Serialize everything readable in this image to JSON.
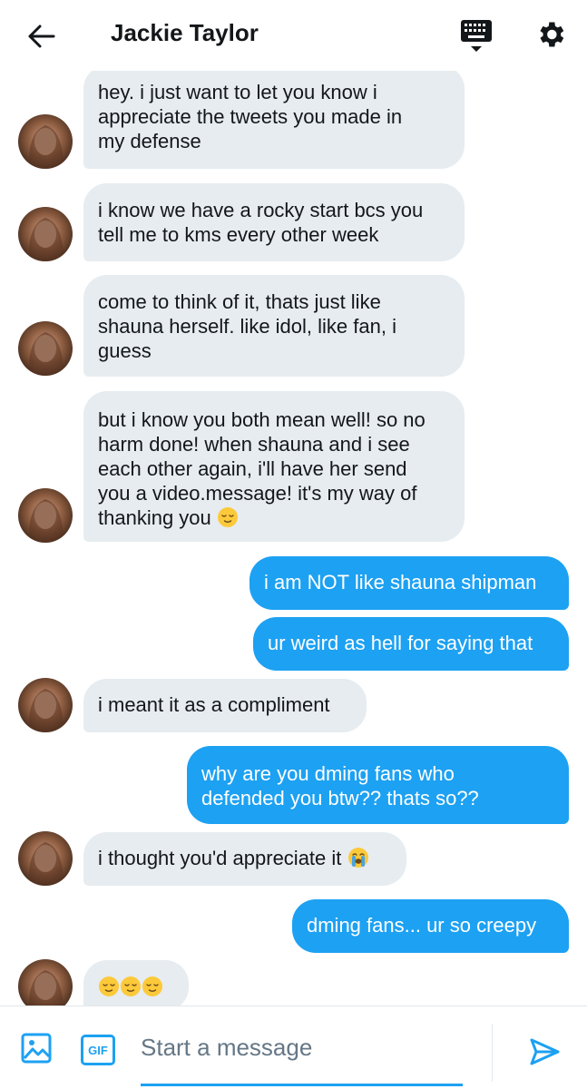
{
  "header": {
    "title": "Jackie Taylor",
    "back_icon": "arrow-left-icon",
    "keyboard_icon": "keyboard-icon",
    "settings_icon": "gear-icon"
  },
  "messages": [
    {
      "from": "them",
      "lines": [
        "hey. i just want to let you know i",
        "appreciate the tweets you made in",
        "my defense"
      ]
    },
    {
      "from": "them",
      "lines": [
        "i know we have a rocky start bcs you",
        "tell me to kms every other week"
      ]
    },
    {
      "from": "them",
      "lines": [
        "come to think of it, thats just like",
        "shauna herself. like idol, like fan, i",
        "guess"
      ]
    },
    {
      "from": "them",
      "lines": [
        "but i know you both mean well! so no",
        "harm done! when shauna and i see",
        "each other again, i'll have her send",
        "you a video.message! it's my way of",
        "thanking you"
      ],
      "emoji": "relieved-face"
    },
    {
      "from": "me",
      "lines": [
        "i am NOT like shauna shipman"
      ]
    },
    {
      "from": "me",
      "lines": [
        "ur weird as hell for saying that"
      ]
    },
    {
      "from": "them",
      "lines": [
        "i meant it as a compliment"
      ]
    },
    {
      "from": "me",
      "lines": [
        "why are you dming fans who",
        "defended you btw?? thats so??"
      ]
    },
    {
      "from": "them",
      "lines": [
        "i thought you'd appreciate it"
      ],
      "emoji": "loudly-crying-face"
    },
    {
      "from": "me",
      "lines": [
        "dming fans... ur so creepy"
      ]
    },
    {
      "from": "them",
      "lines": [],
      "emoji": "relieved-face x3"
    }
  ],
  "composer": {
    "placeholder": "Start a message",
    "gif_label": "GIF",
    "image_icon": "image-icon",
    "send_icon": "send-icon"
  },
  "colors": {
    "accent": "#1da1f2",
    "incoming_bubble": "#e6ecf0",
    "text": "#14171a"
  }
}
